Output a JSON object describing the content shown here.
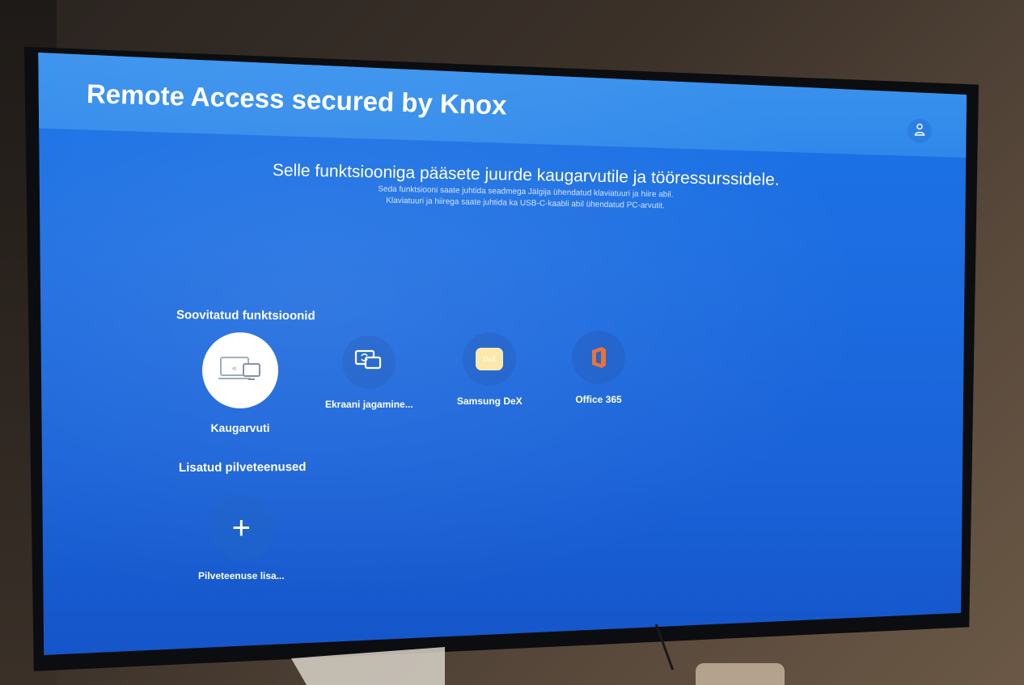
{
  "app": {
    "title": "Remote Access secured by Knox",
    "account_icon": "person-icon"
  },
  "intro": {
    "heading": "Selle funktsiooniga pääsete juurde kaugarvutile ja tööressurssidele.",
    "line1": "Seda funktsiooni saate juhtida seadmega Jälgija ühendatud klaviatuuri ja hiire abil.",
    "line2": "Klaviatuuri ja hiirega saate juhtida ka USB-C-kaabli abil ühendatud PC-arvutit."
  },
  "recommended": {
    "heading": "Soovitatud funktsioonid",
    "items": [
      {
        "label": "Kaugarvuti",
        "icon": "remote-pc-icon",
        "selected": true
      },
      {
        "label": "Ekraani jagamine...",
        "icon": "screen-share-icon",
        "selected": false
      },
      {
        "label": "Samsung DeX",
        "icon": "dex-icon",
        "dex_text": "DeX",
        "selected": false
      },
      {
        "label": "Office 365",
        "icon": "office-icon",
        "selected": false
      }
    ]
  },
  "cloud": {
    "heading": "Lisatud pilveteenused",
    "add_label": "Pilveteenuse lisa...",
    "add_icon": "plus-icon"
  },
  "colors": {
    "screen_blue": "#1a6ae0",
    "header_blue": "#3e95ee",
    "tile_blue": "#1a5fcc",
    "selected_tile": "#ffffff",
    "office_orange": "#ea6b2f",
    "dex_yellow": "#fbe8a6"
  }
}
